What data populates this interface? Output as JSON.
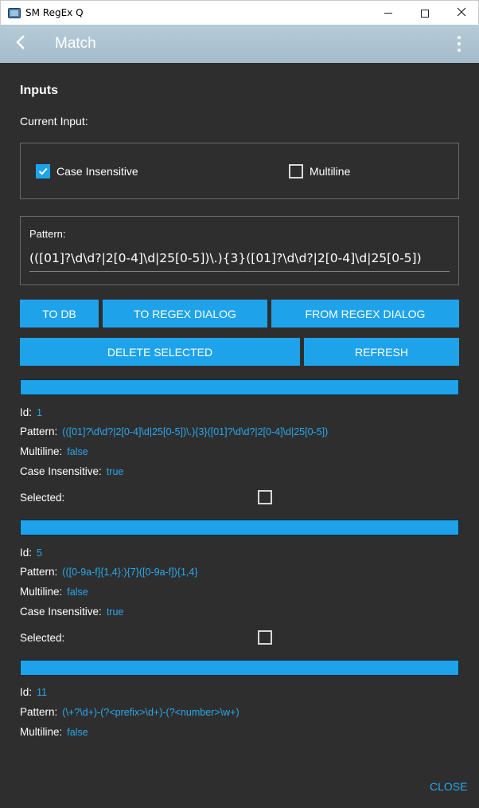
{
  "window": {
    "title": "SM RegEx Q",
    "minimize_glyph": "—",
    "maximize_glyph": "☐",
    "close_glyph": "✕"
  },
  "appbar": {
    "title": "Match",
    "back_icon": "chevron-left-icon",
    "menu_icon": "more-vert-icon",
    "color": "#a9bfcd"
  },
  "inputs": {
    "heading": "Inputs",
    "current_input_label": "Current Input:",
    "case_insensitive_label": "Case Insensitive",
    "case_insensitive_checked": true,
    "multiline_label": "Multiline",
    "multiline_checked": false,
    "pattern_label": "Pattern:",
    "pattern_value": "(([01]?\\d\\d?|2[0-4]\\d|25[0-5])\\.){3}([01]?\\d\\d?|2[0-4]\\d|25[0-5])"
  },
  "buttons": {
    "to_db": "TO DB",
    "to_regex_dialog": "TO REGEX DIALOG",
    "from_regex_dialog": "FROM REGEX DIALOG",
    "delete_selected": "DELETE SELECTED",
    "refresh": "REFRESH",
    "close": "CLOSE"
  },
  "labels": {
    "id": "Id:",
    "pattern": "Pattern:",
    "multiline": "Multiline:",
    "case_insensitive": "Case Insensitive:",
    "selected": "Selected:"
  },
  "records": [
    {
      "id": "1",
      "pattern": "(([01]?\\d\\d?|2[0-4]\\d|25[0-5])\\.){3}([01]?\\d\\d?|2[0-4]\\d|25[0-5])",
      "multiline": "false",
      "case_insensitive": "true",
      "selected": false
    },
    {
      "id": "5",
      "pattern": "(([0-9a-f]{1,4}:){7}([0-9a-f]){1,4}",
      "multiline": "false",
      "case_insensitive": "true",
      "selected": false
    },
    {
      "id": "11",
      "pattern": "(\\+?\\d+)-(?<prefix>\\d+)-(?<number>\\w+)",
      "multiline": "false"
    }
  ],
  "colors": {
    "accent": "#1ea3ea",
    "background": "#2e2e2e",
    "value_text": "#29a9ef"
  }
}
